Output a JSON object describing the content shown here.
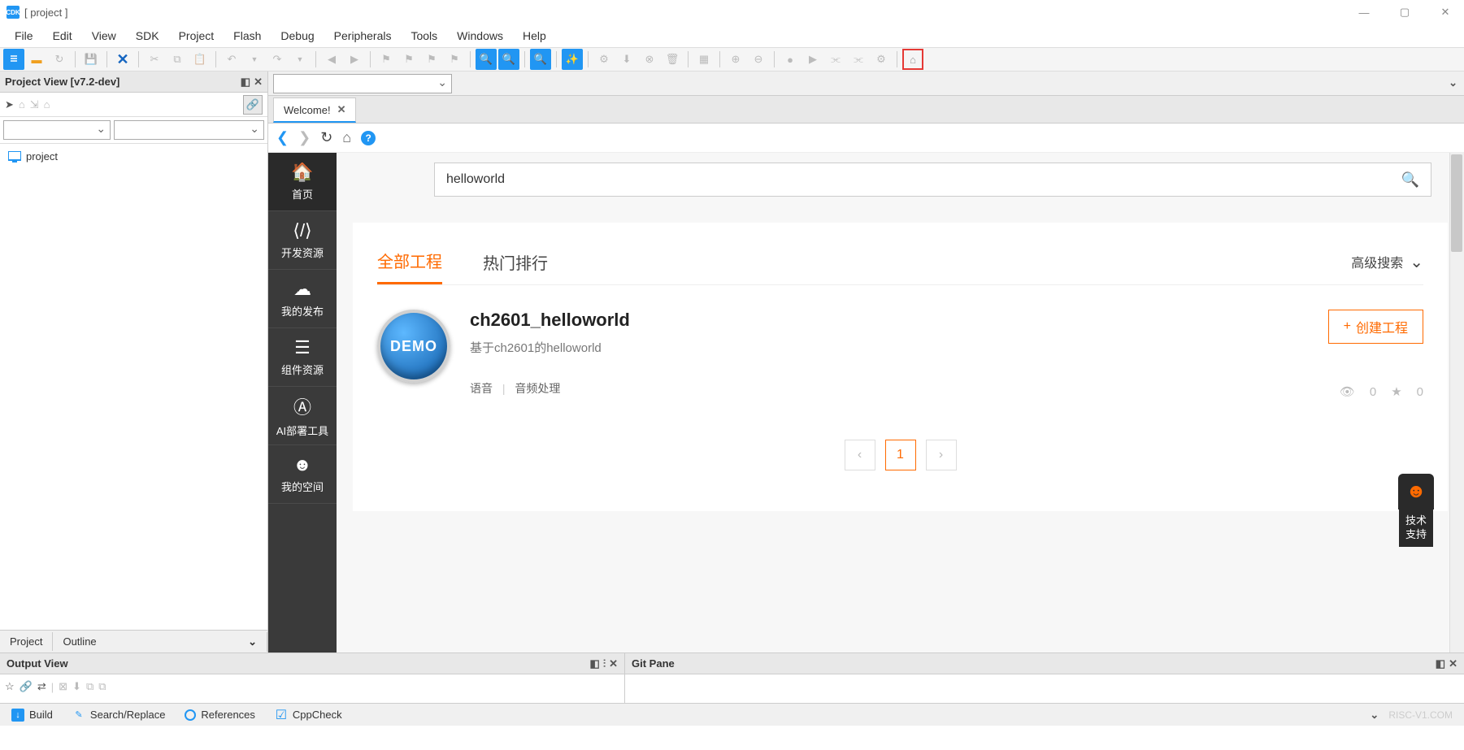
{
  "titlebar": {
    "app_icon_text": "CDK",
    "title": "[ project ]"
  },
  "menubar": [
    "File",
    "Edit",
    "View",
    "SDK",
    "Project",
    "Flash",
    "Debug",
    "Peripherals",
    "Tools",
    "Windows",
    "Help"
  ],
  "project_view": {
    "title": "Project View [v7.2-dev]",
    "tree_root": "project",
    "tabs": {
      "project": "Project",
      "outline": "Outline"
    }
  },
  "editor": {
    "tab_title": "Welcome!",
    "search_value": "helloworld",
    "black_sidebar": [
      {
        "icon": "home",
        "label": "首页"
      },
      {
        "icon": "code",
        "label": "开发资源"
      },
      {
        "icon": "cloud",
        "label": "我的发布"
      },
      {
        "icon": "list",
        "label": "组件资源"
      },
      {
        "icon": "ai",
        "label": "AI部署工具"
      },
      {
        "icon": "face",
        "label": "我的空间"
      }
    ],
    "project_tabs": {
      "all": "全部工程",
      "popular": "热门排行",
      "advanced": "高级搜索"
    },
    "result": {
      "badge": "DEMO",
      "title": "ch2601_helloworld",
      "desc": "基于ch2601的helloworld",
      "tag1": "语音",
      "tag2": "音频处理",
      "create_btn": "创建工程",
      "views": "0",
      "stars": "0"
    },
    "pagination": {
      "current": "1"
    },
    "tech_support": "技术\n支持"
  },
  "bottom": {
    "output_title": "Output View",
    "git_title": "Git Pane"
  },
  "status_tabs": {
    "build": "Build",
    "search": "Search/Replace",
    "references": "References",
    "cppcheck": "CppCheck"
  },
  "watermark": "RISC-V1.COM"
}
